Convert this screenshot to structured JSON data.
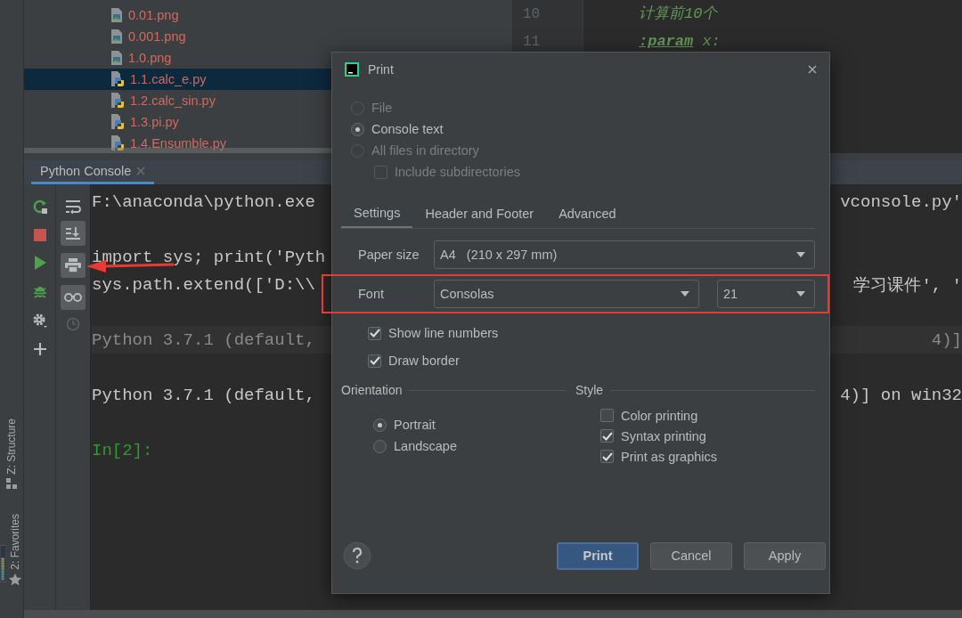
{
  "tool_windows": [
    {
      "label": "Z: Structure",
      "kind": "structure"
    },
    {
      "label": "2: Favorites",
      "kind": "favorites"
    }
  ],
  "project_tree": {
    "items": [
      {
        "name": "0.01.png",
        "kind": "image",
        "selected": false
      },
      {
        "name": "0.001.png",
        "kind": "image",
        "selected": false
      },
      {
        "name": "1.0.png",
        "kind": "image",
        "selected": false
      },
      {
        "name": "1.1.calc_e.py",
        "kind": "python",
        "selected": true
      },
      {
        "name": "1.2.calc_sin.py",
        "kind": "python",
        "selected": false
      },
      {
        "name": "1.3.pi.py",
        "kind": "python",
        "selected": false
      },
      {
        "name": "1.4.Ensumble.py",
        "kind": "python",
        "selected": false
      }
    ]
  },
  "editor": {
    "lines": [
      {
        "number": "10",
        "kind": "docstring",
        "text": "计算前10个"
      },
      {
        "number": "11",
        "kind": "param",
        "keyword": ":param",
        "text": "x:"
      }
    ]
  },
  "console": {
    "tab": "Python Console",
    "toolbar_arrow": true,
    "lines": [
      {
        "kind": "plain",
        "left": "F:\\anaconda\\python.exe",
        "right": "vconsole.py'"
      },
      {
        "kind": "blank"
      },
      {
        "kind": "plain",
        "left": "import sys; print('Pyth"
      },
      {
        "kind": "plain",
        "left": "sys.path.extend(['D:\\\\",
        "right": "学习课件', '"
      },
      {
        "kind": "blank"
      },
      {
        "kind": "highlight",
        "left": "Python 3.7.1 (default,",
        "right": "4)]"
      },
      {
        "kind": "blank"
      },
      {
        "kind": "plain",
        "left": "Python 3.7.1 (default,",
        "right": "4)] on win32"
      },
      {
        "kind": "blank"
      },
      {
        "kind": "prompt",
        "left": "In[2]:"
      }
    ]
  },
  "dialog": {
    "title": "Print",
    "scope": [
      {
        "label": "File",
        "selected": false,
        "disabled": true
      },
      {
        "label": "Console text",
        "selected": true,
        "disabled": false
      },
      {
        "label": "All files in directory",
        "selected": false,
        "disabled": true
      }
    ],
    "include_subdirectories": {
      "label": "Include subdirectories",
      "checked": false,
      "disabled": true
    },
    "tabs": [
      {
        "label": "Settings",
        "selected": true
      },
      {
        "label": "Header and Footer",
        "selected": false
      },
      {
        "label": "Advanced",
        "selected": false
      }
    ],
    "paper_size": {
      "label": "Paper size",
      "value": "A4",
      "detail": "(210 x 297 mm)"
    },
    "font": {
      "label": "Font",
      "value": "Consolas",
      "size": "21",
      "highlighted": true
    },
    "options": [
      {
        "label": "Show line numbers",
        "checked": true
      },
      {
        "label": "Draw border",
        "checked": true
      }
    ],
    "orientation": {
      "label": "Orientation",
      "options": [
        {
          "label": "Portrait",
          "selected": true
        },
        {
          "label": "Landscape",
          "selected": false
        }
      ]
    },
    "style": {
      "label": "Style",
      "options": [
        {
          "label": "Color printing",
          "checked": false
        },
        {
          "label": "Syntax printing",
          "checked": true
        },
        {
          "label": "Print as graphics",
          "checked": true
        }
      ]
    },
    "buttons": [
      {
        "label": "Print",
        "kind": "default"
      },
      {
        "label": "Cancel",
        "kind": "normal"
      },
      {
        "label": "Apply",
        "kind": "normal"
      }
    ]
  }
}
